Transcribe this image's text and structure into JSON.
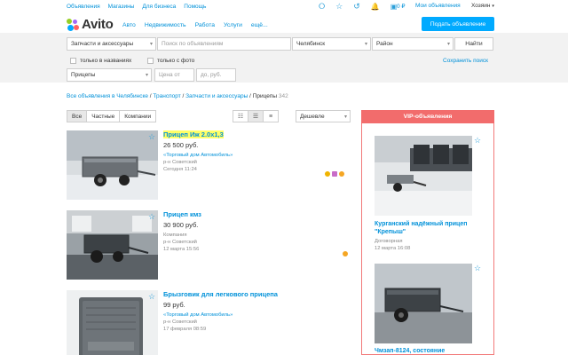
{
  "topnav": {
    "links": [
      "Объявления",
      "Магазины",
      "Для бизнеса",
      "Помощь"
    ],
    "balance": "0 ₽",
    "my_ads": "Мои объявления",
    "user": "Хозяин"
  },
  "logo": {
    "text": "Avito"
  },
  "mainnav": [
    "Авто",
    "Недвижимость",
    "Работа",
    "Услуги",
    "ещё..."
  ],
  "post_button": "Подать объявление",
  "search": {
    "category": "Запчасти и аксессуары",
    "query_placeholder": "Поиск по объявлениям",
    "city": "Челябинск",
    "district": "Район",
    "find": "Найти",
    "only_titles": "только в названиях",
    "only_photo": "только с фото",
    "subcategory": "Прицепы",
    "price_from_placeholder": "Цена от",
    "price_to_placeholder": "до, руб.",
    "save_search": "Сохранить поиск"
  },
  "breadcrumb": {
    "parts": [
      "Все объявления в Челябинске",
      "Транспорт",
      "Запчасти и аксессуары"
    ],
    "current": "Прицепы",
    "count": "342"
  },
  "filter_tabs": [
    "Все",
    "Частные",
    "Компании"
  ],
  "sort": "Дешевле",
  "listings": [
    {
      "title": "Прицеп Иж 2.0х1,3",
      "price": "26 500 руб.",
      "seller": "«Торговый дом Автомобиль»",
      "area": "р-н Советский",
      "date": "Сегодня 11:24",
      "highlighted": true
    },
    {
      "title": "Прицеп кмз",
      "price": "30 900 руб.",
      "seller": "Компания",
      "area": "р-н Советский",
      "date": "12 марта 15:56",
      "highlighted": false
    },
    {
      "title": "Брызговик для легкового прицепа",
      "price": "99 руб.",
      "seller": "«Торговый дом Автомобиль»",
      "area": "р-н Советский",
      "date": "17 февраля 08:59",
      "highlighted": false
    }
  ],
  "vip": {
    "header": "VIP-объявления",
    "cards": [
      {
        "title": "Курганский надёжный прицеп \"Крепыш\"",
        "price": "Договорная",
        "date": "12 марта 16:08"
      },
      {
        "title": "Чмзап-8124, состояние",
        "price": "",
        "date": ""
      }
    ]
  },
  "colors": {
    "link": "#0091d9",
    "accent": "#00aaff",
    "vip": "#f26c6c",
    "highlight": "#ffff66"
  }
}
